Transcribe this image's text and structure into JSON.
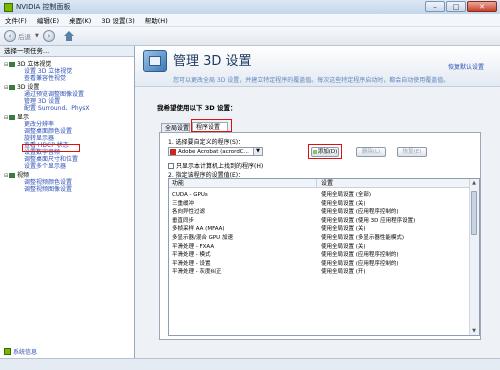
{
  "window": {
    "title": "NVIDIA 控制面板",
    "min": "–",
    "max": "□",
    "close": "✕"
  },
  "menu": [
    "文件(F)",
    "编辑(E)",
    "桌面(K)",
    "3D 设置(3)",
    "帮助(H)"
  ],
  "toolbar": {
    "back_label": "后退",
    "back_icon": "back-arrow-icon",
    "forward_icon": "forward-arrow-icon",
    "home_icon": "home-icon"
  },
  "left_panel": {
    "header": "选择一项任务...",
    "tree": [
      {
        "label": "3D 立体视觉",
        "type": "category",
        "expander": "⊟"
      },
      {
        "label": "设置 3D 立体视觉",
        "type": "link"
      },
      {
        "label": "查看兼容性视觉",
        "type": "link"
      },
      {
        "label": "3D 设置",
        "type": "category",
        "expander": "⊟"
      },
      {
        "label": "通过预览调整图像设置",
        "type": "link"
      },
      {
        "label": "管理 3D 设置",
        "type": "link",
        "selected": true
      },
      {
        "label": "配置 Surround、PhysX",
        "type": "link"
      },
      {
        "label": "显示",
        "type": "category",
        "expander": "⊟"
      },
      {
        "label": "更改分辨率",
        "type": "link"
      },
      {
        "label": "调整桌面颜色设置",
        "type": "link"
      },
      {
        "label": "旋转显示器",
        "type": "link"
      },
      {
        "label": "查看 HDCP 状态",
        "type": "link"
      },
      {
        "label": "设置数字音频",
        "type": "link"
      },
      {
        "label": "调整桌面尺寸和位置",
        "type": "link"
      },
      {
        "label": "设置多个显示器",
        "type": "link"
      },
      {
        "label": "视频",
        "type": "category",
        "expander": "⊟"
      },
      {
        "label": "调整视频颜色设置",
        "type": "link"
      },
      {
        "label": "调整视频图像设置",
        "type": "link"
      }
    ],
    "system_info": "系统信息"
  },
  "main": {
    "title": "管理 3D 设置",
    "restore_defaults": "恢复默认设置",
    "description": "您可以更改全局 3D 设置，并建立特定程序的覆盖值。每次这些特定程序启动时，都会自动使用覆盖值。",
    "section_label": "我希望使用以下 3D 设置：",
    "tabs": [
      "全局设置",
      "程序设置"
    ],
    "active_tab": "程序设置",
    "step1": "1. 选择要自定义的程序(S)：",
    "program_selected": "Adobe Acrobat (acrordC...",
    "buttons": {
      "add": "添加(D)",
      "remove": "删除(L)",
      "restore": "恢复(E)"
    },
    "checkbox_label": "只显示本计算机上找到的程序(H)",
    "step2": "2. 指定该程序的设置值(E)：",
    "table": {
      "headers": [
        "功能",
        "设置"
      ],
      "rows": [
        [
          "CUDA - GPUs",
          "使用全局设置 (全部)"
        ],
        [
          "三重缓冲",
          "使用全局设置 (关)"
        ],
        [
          "各向异性过滤",
          "使用全局设置 (应用程序控制的)"
        ],
        [
          "垂直同步",
          "使用全局设置 (使用 3D 应用程序设置)"
        ],
        [
          "多帧采样 AA (MFAA)",
          "使用全局设置 (关)"
        ],
        [
          "多显示器/混合 GPU 加速",
          "使用全局设置 (多显示器性能模式)"
        ],
        [
          "平滑处理 - FXAA",
          "使用全局设置 (关)"
        ],
        [
          "平滑处理 - 模式",
          "使用全局设置 (应用程序控制的)"
        ],
        [
          "平滑处理 - 设置",
          "使用全局设置 (应用程序控制的)"
        ],
        [
          "平滑处理 - 灰度纠正",
          "使用全局设置 (开)"
        ]
      ]
    }
  }
}
